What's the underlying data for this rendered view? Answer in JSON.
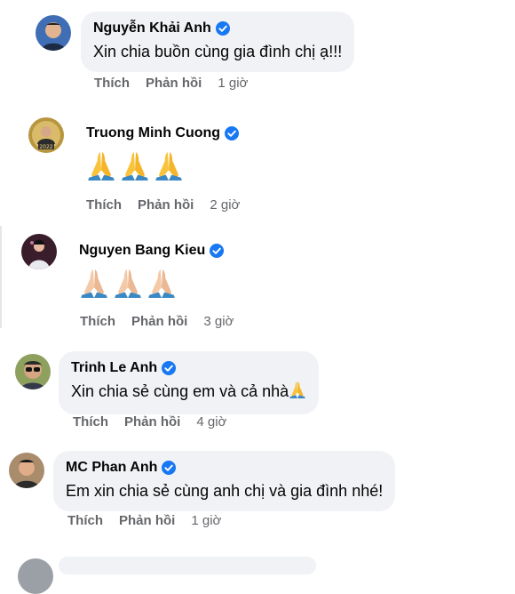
{
  "actions": {
    "like_label": "Thích",
    "reply_label": "Phản hồi"
  },
  "colors": {
    "bubble_bg": "#f0f2f5",
    "verified_badge": "#1877f2",
    "meta_text": "#65676b"
  },
  "comments": [
    {
      "author": "Nguyễn Khải Anh",
      "verified": true,
      "text": "Xin chia buồn cùng gia đình chị ạ!!!",
      "time": "1 giờ",
      "avatar_icon": "avatar-man-icon"
    },
    {
      "author": "Truong Minh Cuong",
      "verified": true,
      "reaction_icons": [
        "folded-hands-icon",
        "folded-hands-icon",
        "folded-hands-icon"
      ],
      "reaction_skin_tone": "default-yellow",
      "time": "2 giờ",
      "avatar_icon": "avatar-2022-icon"
    },
    {
      "author": "Nguyen Bang Kieu",
      "verified": true,
      "reaction_icons": [
        "folded-hands-icon",
        "folded-hands-icon",
        "folded-hands-icon"
      ],
      "reaction_skin_tone": "light",
      "time": "3 giờ",
      "avatar_icon": "avatar-singer-icon"
    },
    {
      "author": "Trinh Le Anh",
      "verified": true,
      "text": "Xin chia sẻ cùng em và cả nhà",
      "trailing_icon": "folded-hands-icon",
      "time": "4 giờ",
      "avatar_icon": "avatar-glasses-icon"
    },
    {
      "author": "MC Phan Anh",
      "verified": true,
      "text": "Em xin chia sẻ cùng anh chị và gia đình nhé!",
      "time": "1 giờ",
      "avatar_icon": "avatar-man-icon"
    }
  ]
}
